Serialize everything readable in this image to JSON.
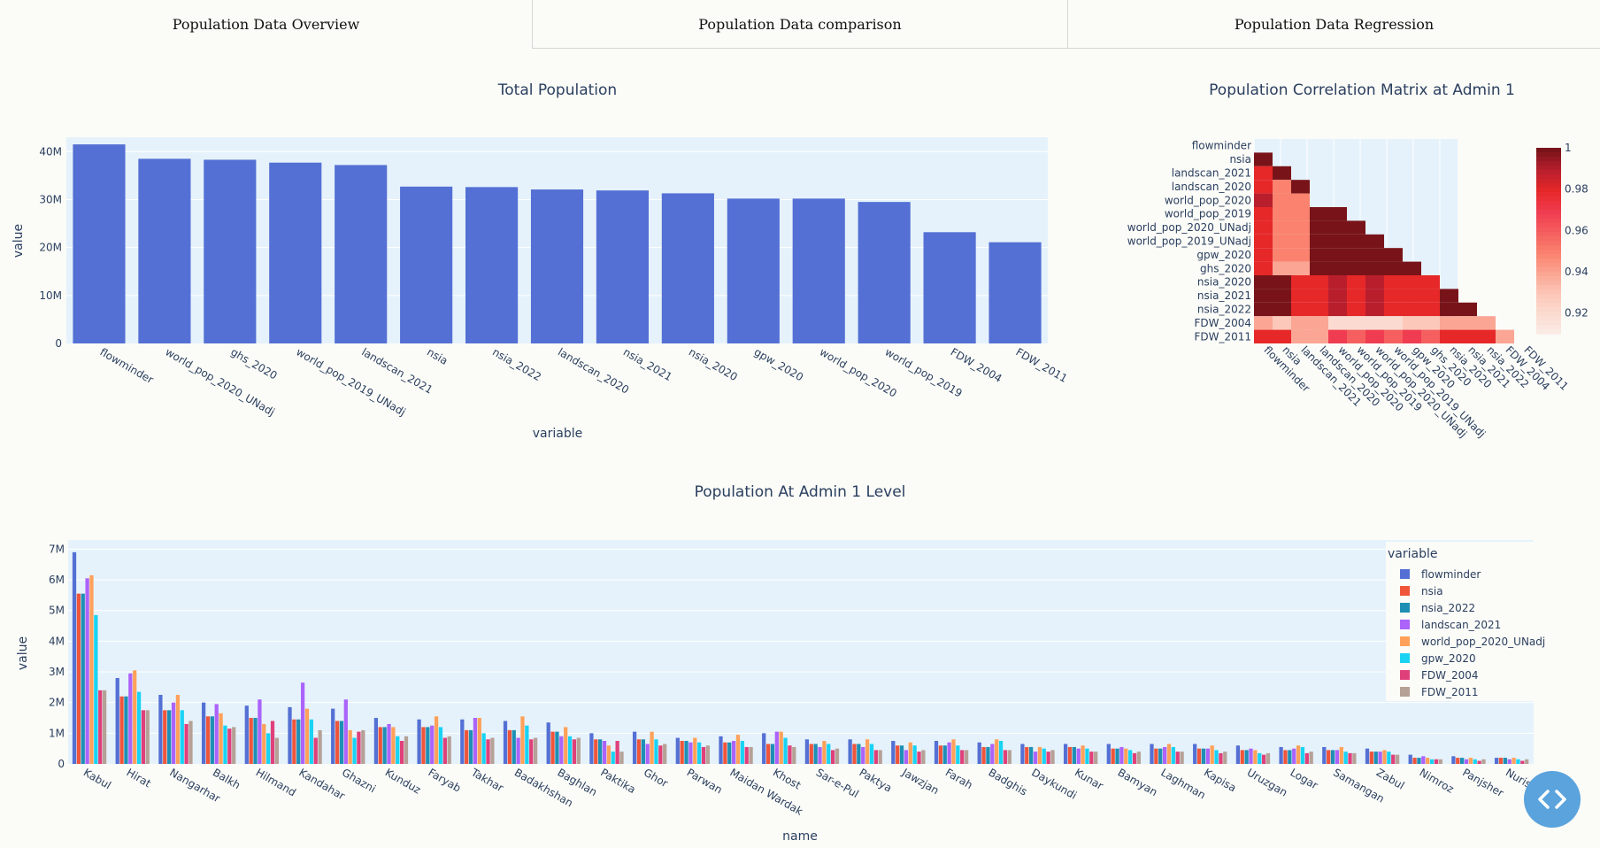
{
  "tabs": [
    {
      "label": "Population Data Overview"
    },
    {
      "label": "Population Data comparison"
    },
    {
      "label": "Population Data Regression"
    }
  ],
  "colors": {
    "bar": "#5470d4",
    "plot_bg": "#e5f2fb",
    "grid": "#ffffff",
    "text": "#2a3f5f",
    "fab": "#5aa3dd"
  },
  "chart_data": [
    {
      "type": "bar",
      "title": "Total Population",
      "xlabel": "variable",
      "ylabel": "value",
      "categories": [
        "flowminder",
        "world_pop_2020_UNadj",
        "ghs_2020",
        "world_pop_2019_UNadj",
        "landscan_2021",
        "nsia",
        "nsia_2022",
        "landscan_2020",
        "nsia_2021",
        "nsia_2020",
        "gpw_2020",
        "world_pop_2020",
        "world_pop_2019",
        "FDW_2004",
        "FDW_2011"
      ],
      "values": [
        41.5,
        38.5,
        38.3,
        37.7,
        37.2,
        32.7,
        32.6,
        32.1,
        31.9,
        31.3,
        30.2,
        30.2,
        29.5,
        23.2,
        21.1
      ],
      "ylim": [
        0,
        43
      ],
      "yticks": [
        0,
        10,
        20,
        30,
        40
      ],
      "ytick_labels": [
        "0",
        "10M",
        "20M",
        "30M",
        "40M"
      ],
      "grid": true
    },
    {
      "type": "heatmap",
      "title": "Population Correlation Matrix at Admin 1",
      "rows": [
        "flowminder",
        "nsia",
        "landscan_2021",
        "landscan_2020",
        "world_pop_2020",
        "world_pop_2019",
        "world_pop_2020_UNadj",
        "world_pop_2019_UNadj",
        "gpw_2020",
        "ghs_2020",
        "nsia_2020",
        "nsia_2021",
        "nsia_2022",
        "FDW_2004",
        "FDW_2011"
      ],
      "columns": [
        "flowminder",
        "nsia",
        "landscan_2021",
        "landscan_2020",
        "world_pop_2020",
        "world_pop_2019",
        "world_pop_2020_UNadj",
        "world_pop_2019_UNadj",
        "gpw_2020",
        "ghs_2020",
        "nsia_2020",
        "nsia_2021",
        "nsia_2022",
        "FDW_2004",
        "FDW_2011"
      ],
      "z": [
        [],
        [
          1.0
        ],
        [
          0.98,
          1.0
        ],
        [
          0.98,
          0.95,
          1.0
        ],
        [
          0.99,
          0.95,
          0.95
        ],
        [
          0.98,
          0.95,
          0.95,
          1.0,
          1.0
        ],
        [
          0.98,
          0.95,
          0.95,
          1.0,
          1.0,
          1.0
        ],
        [
          0.98,
          0.95,
          0.95,
          1.0,
          1.0,
          1.0,
          1.0
        ],
        [
          0.98,
          0.95,
          0.95,
          1.0,
          1.0,
          1.0,
          1.0,
          1.0
        ],
        [
          0.98,
          0.94,
          0.94,
          1.0,
          1.0,
          1.0,
          1.0,
          1.0,
          1.0
        ],
        [
          1.0,
          1.0,
          0.98,
          0.98,
          0.99,
          0.98,
          0.99,
          0.98,
          0.98,
          0.98
        ],
        [
          1.0,
          1.0,
          0.98,
          0.98,
          0.99,
          0.98,
          0.99,
          0.98,
          0.98,
          0.98,
          1.0
        ],
        [
          1.0,
          1.0,
          0.98,
          0.98,
          0.99,
          0.98,
          0.99,
          0.98,
          0.98,
          0.98,
          1.0,
          1.0
        ],
        [
          0.94,
          0.93,
          0.94,
          0.94,
          0.92,
          0.92,
          0.92,
          0.92,
          0.93,
          0.93,
          0.94,
          0.94,
          0.94
        ],
        [
          0.98,
          0.98,
          0.94,
          0.94,
          0.97,
          0.96,
          0.97,
          0.96,
          0.97,
          0.96,
          0.98,
          0.98,
          0.98,
          0.94
        ]
      ],
      "zmin": 0.91,
      "zmax": 1.0,
      "colorbar_ticks": [
        0.92,
        0.94,
        0.96,
        0.98,
        1
      ],
      "colorbar_labels": [
        "0.92",
        "0.94",
        "0.96",
        "0.98",
        "1"
      ]
    },
    {
      "type": "bar",
      "title": "Population At Admin 1 Level",
      "xlabel": "name",
      "ylabel": "value",
      "legend_title": "variable",
      "legend_position": "right",
      "ylim": [
        0,
        7.3
      ],
      "yticks": [
        0,
        1,
        2,
        3,
        4,
        5,
        6,
        7
      ],
      "ytick_labels": [
        "0",
        "1M",
        "2M",
        "3M",
        "4M",
        "5M",
        "6M",
        "7M"
      ],
      "categories": [
        "Kabul",
        "Hirat",
        "Nangarhar",
        "Balkh",
        "Hilmand",
        "Kandahar",
        "Ghazni",
        "Kunduz",
        "Faryab",
        "Takhar",
        "Badakhshan",
        "Baghlan",
        "Paktika",
        "Ghor",
        "Parwan",
        "Maidan Wardak",
        "Khost",
        "Sar-e-Pul",
        "Paktya",
        "Jawzjan",
        "Farah",
        "Badghis",
        "Daykundi",
        "Kunar",
        "Bamyan",
        "Laghman",
        "Kapisa",
        "Uruzgan",
        "Logar",
        "Samangan",
        "Zabul",
        "Nimroz",
        "Panjsher",
        "Nuristan"
      ],
      "series": [
        {
          "name": "flowminder",
          "color": "#5470d4",
          "values": [
            6.9,
            2.8,
            2.25,
            2.0,
            1.9,
            1.85,
            1.8,
            1.5,
            1.45,
            1.45,
            1.4,
            1.35,
            1.0,
            1.05,
            0.85,
            0.9,
            1.0,
            0.8,
            0.8,
            0.75,
            0.75,
            0.7,
            0.65,
            0.65,
            0.65,
            0.65,
            0.65,
            0.6,
            0.55,
            0.55,
            0.5,
            0.3,
            0.25,
            0.2
          ]
        },
        {
          "name": "nsia",
          "color": "#ef553b",
          "values": [
            5.55,
            2.2,
            1.75,
            1.55,
            1.5,
            1.45,
            1.4,
            1.2,
            1.2,
            1.1,
            1.1,
            1.05,
            0.8,
            0.8,
            0.75,
            0.7,
            0.65,
            0.65,
            0.65,
            0.6,
            0.6,
            0.55,
            0.55,
            0.55,
            0.5,
            0.5,
            0.5,
            0.45,
            0.45,
            0.45,
            0.4,
            0.2,
            0.2,
            0.2
          ]
        },
        {
          "name": "nsia_2022",
          "color": "#1f8fb4",
          "values": [
            5.55,
            2.2,
            1.75,
            1.55,
            1.5,
            1.45,
            1.4,
            1.2,
            1.2,
            1.1,
            1.1,
            1.05,
            0.8,
            0.8,
            0.75,
            0.7,
            0.65,
            0.65,
            0.65,
            0.6,
            0.6,
            0.55,
            0.55,
            0.55,
            0.5,
            0.5,
            0.5,
            0.45,
            0.45,
            0.45,
            0.4,
            0.2,
            0.2,
            0.2
          ]
        },
        {
          "name": "landscan_2021",
          "color": "#ab63fa",
          "values": [
            6.05,
            2.95,
            2.0,
            1.95,
            2.1,
            2.65,
            2.1,
            1.3,
            1.25,
            1.5,
            0.85,
            0.9,
            0.75,
            0.65,
            0.7,
            0.75,
            1.05,
            0.55,
            0.55,
            0.45,
            0.7,
            0.65,
            0.4,
            0.5,
            0.55,
            0.55,
            0.5,
            0.5,
            0.5,
            0.45,
            0.4,
            0.25,
            0.15,
            0.15
          ]
        },
        {
          "name": "world_pop_2020_UNadj",
          "color": "#ffa15a",
          "values": [
            6.15,
            3.05,
            2.25,
            1.65,
            1.3,
            1.8,
            1.1,
            1.2,
            1.55,
            1.5,
            1.55,
            1.2,
            0.6,
            1.05,
            0.85,
            0.95,
            1.05,
            0.75,
            0.8,
            0.7,
            0.8,
            0.8,
            0.55,
            0.6,
            0.5,
            0.65,
            0.6,
            0.45,
            0.6,
            0.55,
            0.45,
            0.2,
            0.2,
            0.2
          ]
        },
        {
          "name": "gpw_2020",
          "color": "#19d3f3",
          "values": [
            4.85,
            2.35,
            1.75,
            1.25,
            1.0,
            1.45,
            0.85,
            0.9,
            1.2,
            1.0,
            1.25,
            0.9,
            0.4,
            0.8,
            0.7,
            0.75,
            0.85,
            0.65,
            0.65,
            0.6,
            0.6,
            0.75,
            0.5,
            0.5,
            0.45,
            0.55,
            0.45,
            0.35,
            0.55,
            0.4,
            0.4,
            0.15,
            0.15,
            0.15
          ]
        },
        {
          "name": "FDW_2004",
          "color": "#e0407a",
          "values": [
            2.4,
            1.75,
            1.3,
            1.15,
            1.4,
            0.85,
            1.05,
            0.75,
            0.85,
            0.8,
            0.8,
            0.8,
            0.75,
            0.6,
            0.55,
            0.55,
            0.6,
            0.45,
            0.45,
            0.4,
            0.45,
            0.45,
            0.4,
            0.4,
            0.35,
            0.4,
            0.35,
            0.3,
            0.35,
            0.35,
            0.3,
            0.15,
            0.1,
            0.1
          ]
        },
        {
          "name": "FDW_2011",
          "color": "#b6a197",
          "values": [
            2.4,
            1.75,
            1.4,
            1.2,
            0.85,
            1.1,
            1.1,
            0.9,
            0.9,
            0.85,
            0.85,
            0.85,
            0.4,
            0.65,
            0.6,
            0.55,
            0.55,
            0.5,
            0.45,
            0.45,
            0.45,
            0.45,
            0.45,
            0.4,
            0.4,
            0.4,
            0.4,
            0.35,
            0.4,
            0.35,
            0.3,
            0.15,
            0.15,
            0.15
          ]
        }
      ],
      "grid": true
    }
  ],
  "legend_series_order": [
    "flowminder",
    "nsia",
    "nsia_2022",
    "landscan_2021",
    "world_pop_2020_UNadj",
    "gpw_2020",
    "FDW_2004",
    "FDW_2011"
  ]
}
